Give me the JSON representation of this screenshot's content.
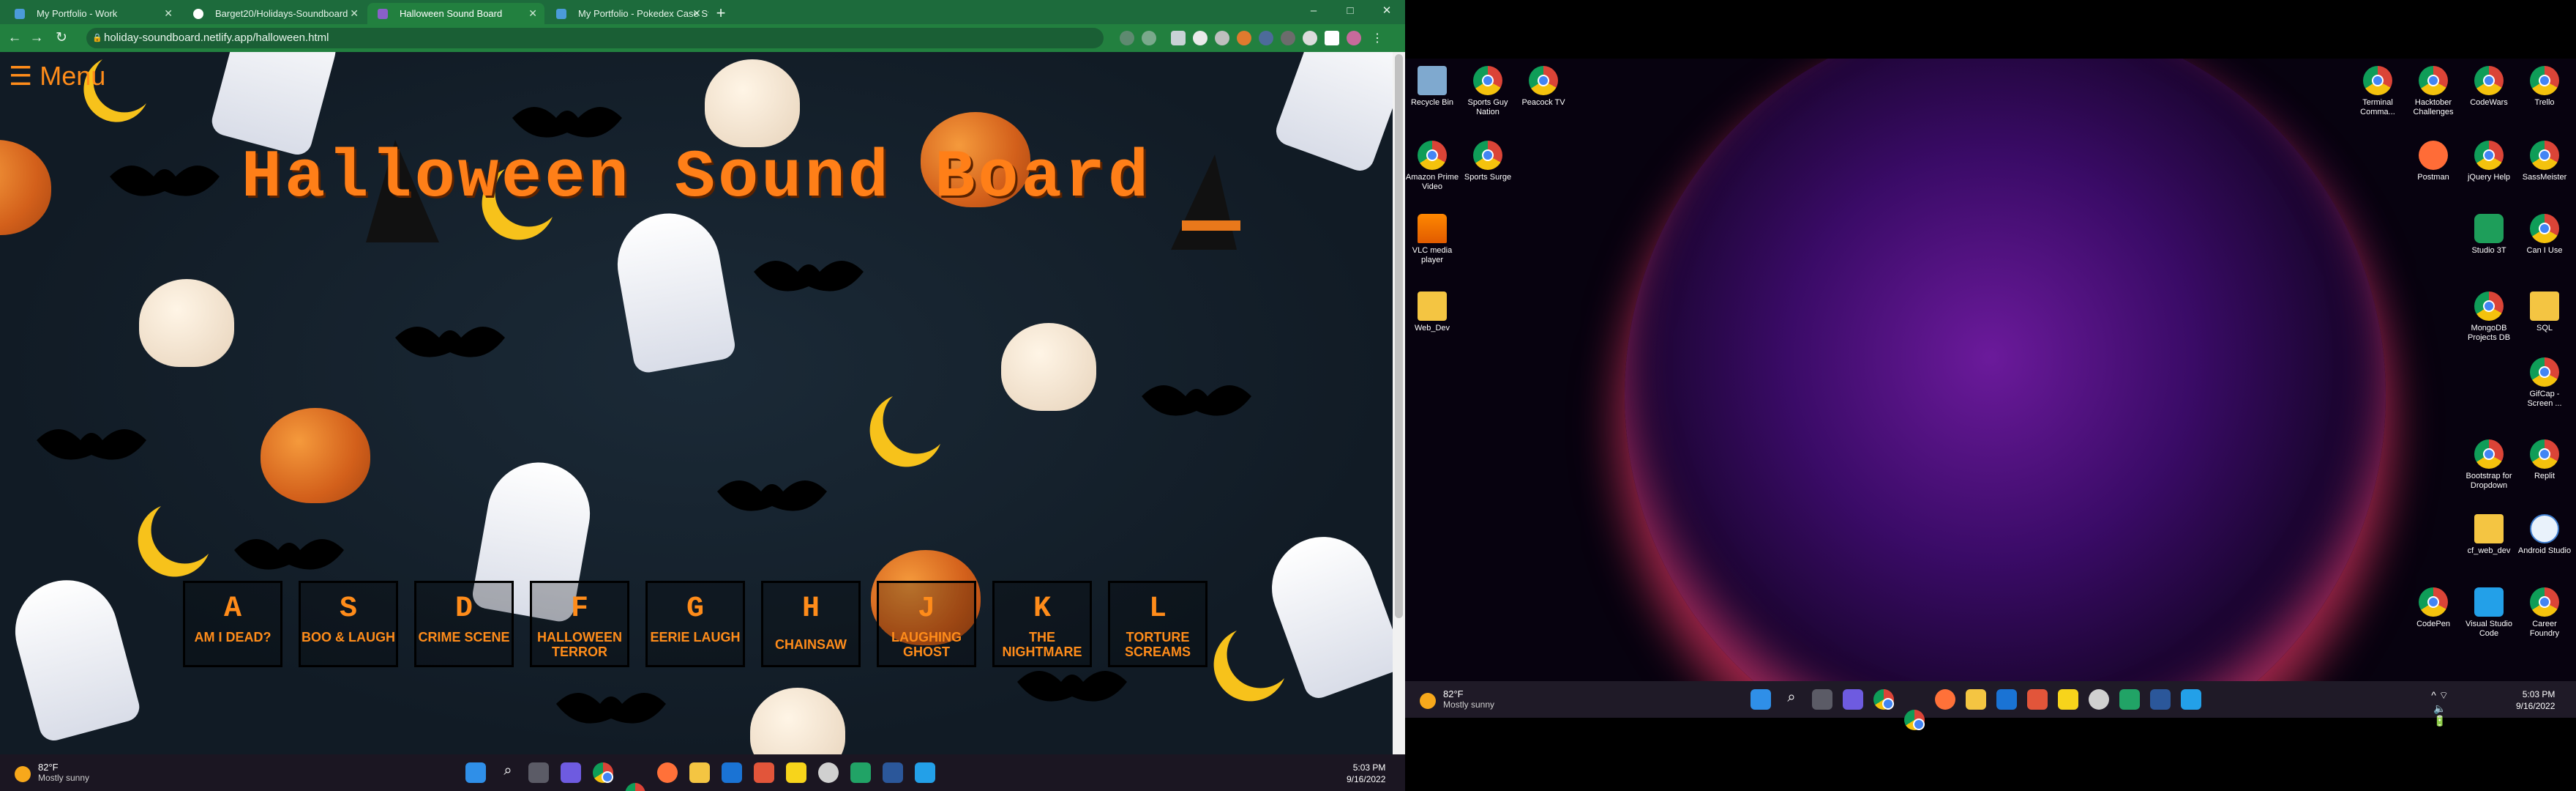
{
  "browser": {
    "tabs": [
      {
        "label": "My Portfolio - Work",
        "active": false
      },
      {
        "label": "Barget20/Holidays-Soundboard",
        "active": false
      },
      {
        "label": "Halloween Sound Board",
        "active": true
      },
      {
        "label": "My Portfolio - Pokedex Case Stu",
        "active": false
      }
    ],
    "new_tab": "+",
    "url": "holiday-soundboard.netlify.app/halloween.html",
    "window_controls": [
      "–",
      "□",
      "✕"
    ]
  },
  "page": {
    "menu_label": "☰ Menu",
    "title": "Halloween Sound Board",
    "keys": [
      {
        "key": "A",
        "sound": "Am I Dead?"
      },
      {
        "key": "S",
        "sound": "BOO & Laugh"
      },
      {
        "key": "D",
        "sound": "Crime Scene"
      },
      {
        "key": "F",
        "sound": "Halloween Terror"
      },
      {
        "key": "G",
        "sound": "Eerie Laugh"
      },
      {
        "key": "H",
        "sound": "Chainsaw"
      },
      {
        "key": "J",
        "sound": "Laughing Ghost"
      },
      {
        "key": "K",
        "sound": "The Nightmare"
      },
      {
        "key": "L",
        "sound": "Torture Screams"
      }
    ]
  },
  "taskbar_left": {
    "weather_temp": "82°F",
    "weather_desc": "Mostly sunny",
    "time": "5:03 PM",
    "date": "9/16/2022"
  },
  "desktop": {
    "icons_left": [
      {
        "label": "Recycle Bin",
        "icon": "recycle-bin-icon"
      },
      {
        "label": "Sports Guy Nation",
        "icon": "chrome-icon"
      },
      {
        "label": "Peacock TV",
        "icon": "chrome-icon"
      },
      {
        "label": "Amazon Prime Video",
        "icon": "chrome-icon"
      },
      {
        "label": "Sports Surge",
        "icon": "chrome-icon"
      },
      {
        "label": "VLC media player",
        "icon": "vlc-icon"
      },
      {
        "label": "Web_Dev",
        "icon": "folder-icon"
      }
    ],
    "icons_right": [
      {
        "label": "Terminal Comma...",
        "icon": "chrome-icon"
      },
      {
        "label": "Hacktober Challenges",
        "icon": "chrome-icon"
      },
      {
        "label": "CodeWars",
        "icon": "chrome-icon"
      },
      {
        "label": "Trello",
        "icon": "chrome-icon"
      },
      {
        "label": "Postman",
        "icon": "postman-icon"
      },
      {
        "label": "jQuery Help",
        "icon": "chrome-icon"
      },
      {
        "label": "SassMeister",
        "icon": "chrome-icon"
      },
      {
        "label": "Studio 3T",
        "icon": "studio3t-icon"
      },
      {
        "label": "Can I Use",
        "icon": "chrome-icon"
      },
      {
        "label": "MongoDB Projects DB",
        "icon": "chrome-icon"
      },
      {
        "label": "SQL",
        "icon": "folder-icon"
      },
      {
        "label": "GifCap - Screen ...",
        "icon": "chrome-icon"
      },
      {
        "label": "Bootstrap for Dropdown",
        "icon": "chrome-icon"
      },
      {
        "label": "Replit",
        "icon": "chrome-icon"
      },
      {
        "label": "cf_web_dev",
        "icon": "folder-icon"
      },
      {
        "label": "Android Studio",
        "icon": "android-studio-icon"
      },
      {
        "label": "CodePen",
        "icon": "chrome-icon"
      },
      {
        "label": "Visual Studio Code",
        "icon": "vscode-icon"
      },
      {
        "label": "Career Foundry",
        "icon": "chrome-icon"
      }
    ]
  },
  "taskbar_right": {
    "weather_temp": "82°F",
    "weather_desc": "Mostly sunny",
    "time": "5:03 PM",
    "date": "9/16/2022"
  },
  "colors": {
    "browser_frame": "#22803f",
    "page_background": "#121c26",
    "accent_orange": "#ff7f18"
  }
}
